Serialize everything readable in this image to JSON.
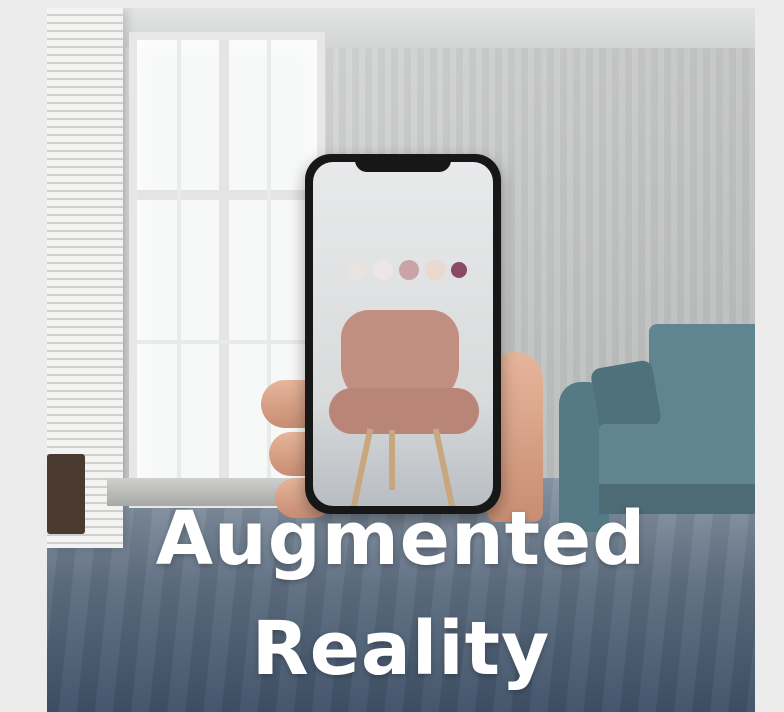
{
  "poster": {
    "title_line1": "Augmented",
    "title_line2": "Reality"
  },
  "swatch_colors": [
    "#e7e3e1",
    "#ece7e6",
    "#c9a3a6",
    "#e9d9cf",
    "#8a4a63"
  ],
  "icons": {
    "phone": "smartphone-icon"
  }
}
